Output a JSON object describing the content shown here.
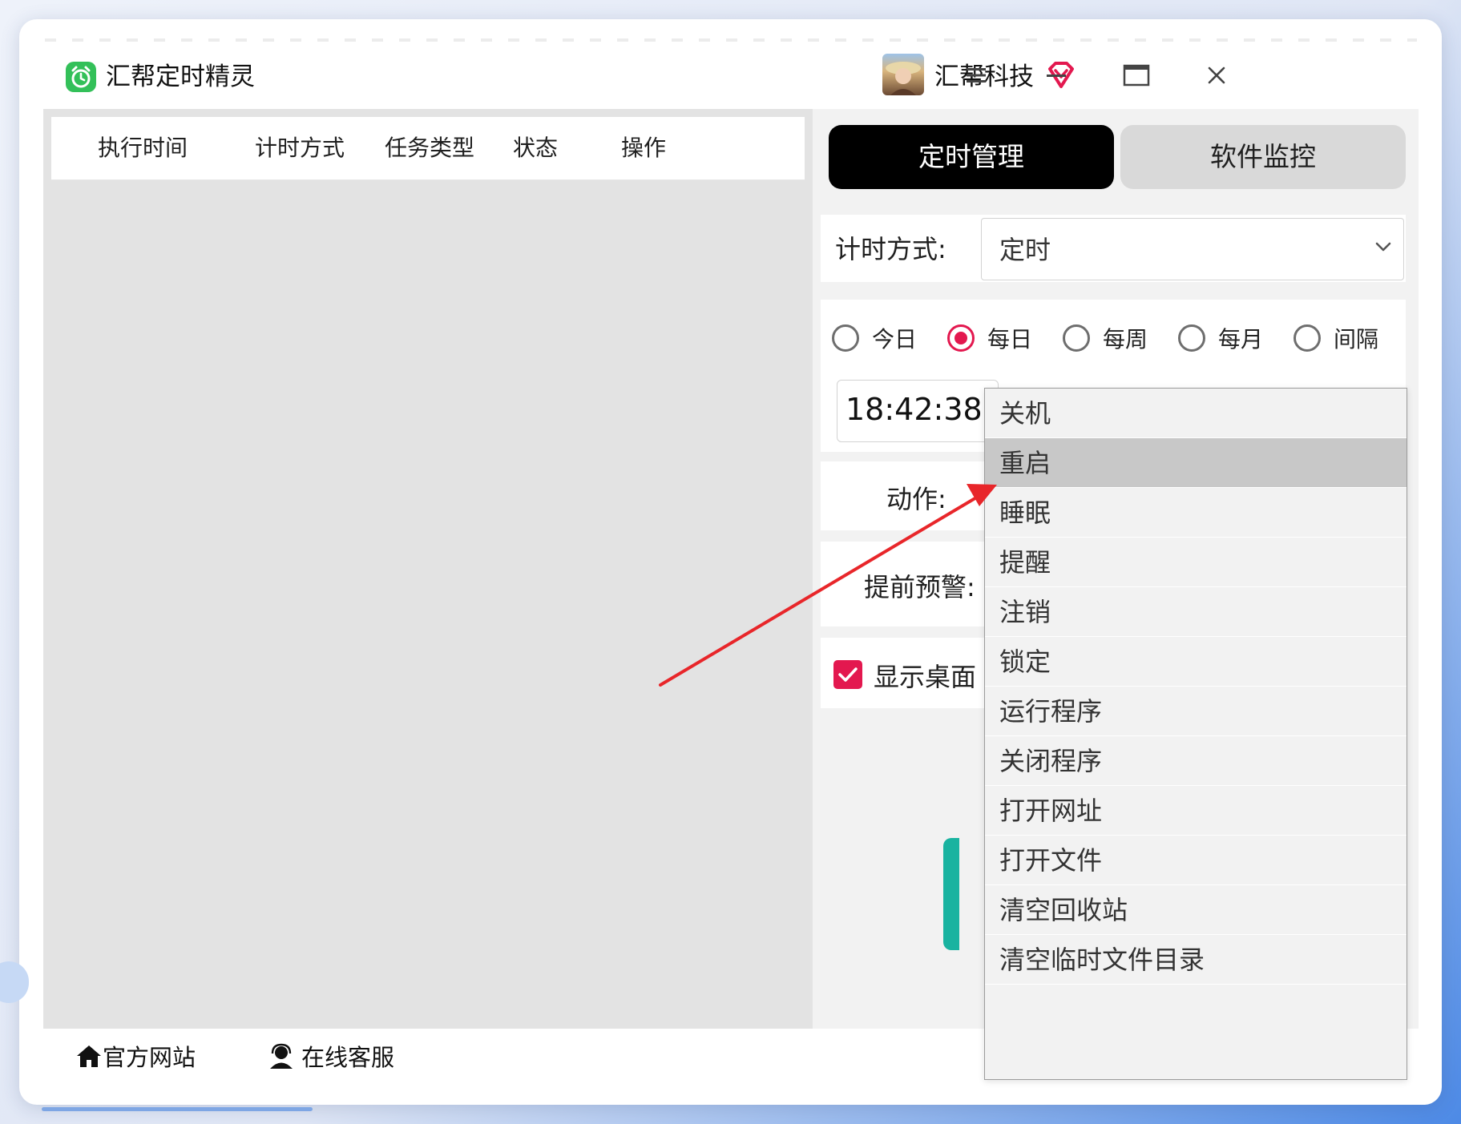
{
  "app": {
    "title": "汇帮定时精灵",
    "company": "汇帮科技"
  },
  "window_controls": {
    "menu_icon": "hamburger-icon",
    "minimize_icon": "minimize-icon",
    "maximize_icon": "maximize-icon",
    "close_icon": "close-icon"
  },
  "table": {
    "headers": [
      "执行时间",
      "计时方式",
      "任务类型",
      "状态",
      "操作"
    ]
  },
  "tabs": {
    "active": "定时管理",
    "inactive": "软件监控"
  },
  "form": {
    "timing_label": "计时方式:",
    "timing_value": "定时",
    "radios": [
      {
        "label": "今日",
        "checked": false
      },
      {
        "label": "每日",
        "checked": true
      },
      {
        "label": "每周",
        "checked": false
      },
      {
        "label": "每月",
        "checked": false
      },
      {
        "label": "间隔",
        "checked": false
      }
    ],
    "time_value": "18:42:38",
    "action_label": "动作:",
    "warning_label": "提前预警:",
    "show_desktop_label": "显示桌面"
  },
  "dropdown": {
    "hovered_index": 1,
    "options": [
      "关机",
      "重启",
      "睡眠",
      "提醒",
      "注销",
      "锁定",
      "运行程序",
      "关闭程序",
      "打开网址",
      "打开文件",
      "清空回收站",
      "清空临时文件目录"
    ]
  },
  "statusbar": {
    "website_label": "官方网站",
    "support_label": "在线客服"
  },
  "colors": {
    "accent": "#e3184f",
    "logo_green": "#33c059",
    "tab_active_bg": "#000000",
    "annotation_arrow": "#e8262a"
  }
}
